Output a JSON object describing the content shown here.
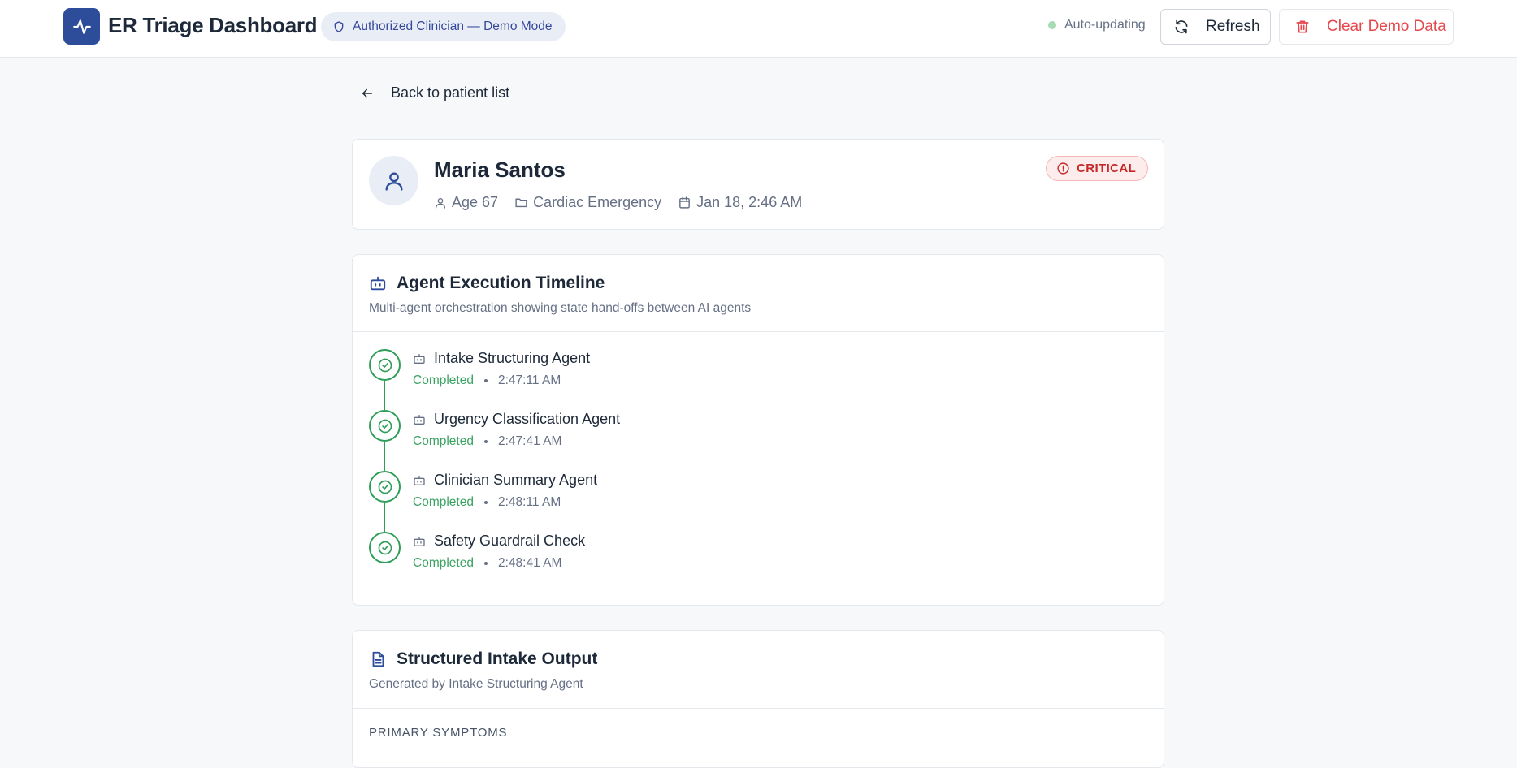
{
  "header": {
    "title": "ER Triage Dashboard",
    "auth_badge": "Authorized Clinician — Demo Mode",
    "auto_status": "Auto-updating",
    "refresh_label": "Refresh",
    "clear_label": "Clear Demo Data",
    "brand_color": "#2d4d9a",
    "danger_color": "#e5484d"
  },
  "nav": {
    "back_label": "Back to patient list"
  },
  "patient": {
    "name": "Maria Santos",
    "age": "Age 67",
    "category": "Cardiac Emergency",
    "arrived": "Jan 18, 2:46 AM",
    "severity": "CRITICAL",
    "severity_color": "#c62828"
  },
  "timeline": {
    "title": "Agent Execution Timeline",
    "subtitle": "Multi-agent orchestration showing state hand-offs between AI agents",
    "status_color": "#2e9e58",
    "steps": [
      {
        "name": "Intake Structuring Agent",
        "status": "Completed",
        "time": "2:47:11 AM"
      },
      {
        "name": "Urgency Classification Agent",
        "status": "Completed",
        "time": "2:47:41 AM"
      },
      {
        "name": "Clinician Summary Agent",
        "status": "Completed",
        "time": "2:48:11 AM"
      },
      {
        "name": "Safety Guardrail Check",
        "status": "Completed",
        "time": "2:48:41 AM"
      }
    ]
  },
  "intake": {
    "title": "Structured Intake Output",
    "subtitle": "Generated by Intake Structuring Agent",
    "section_label": "PRIMARY SYMPTOMS"
  },
  "icons": [
    "activity-icon",
    "shield-icon",
    "refresh-icon",
    "trash-icon",
    "arrow-left-icon",
    "user-icon",
    "folder-icon",
    "calendar-icon",
    "alert-circle-icon",
    "bot-icon",
    "check-circle-icon",
    "file-text-icon"
  ]
}
